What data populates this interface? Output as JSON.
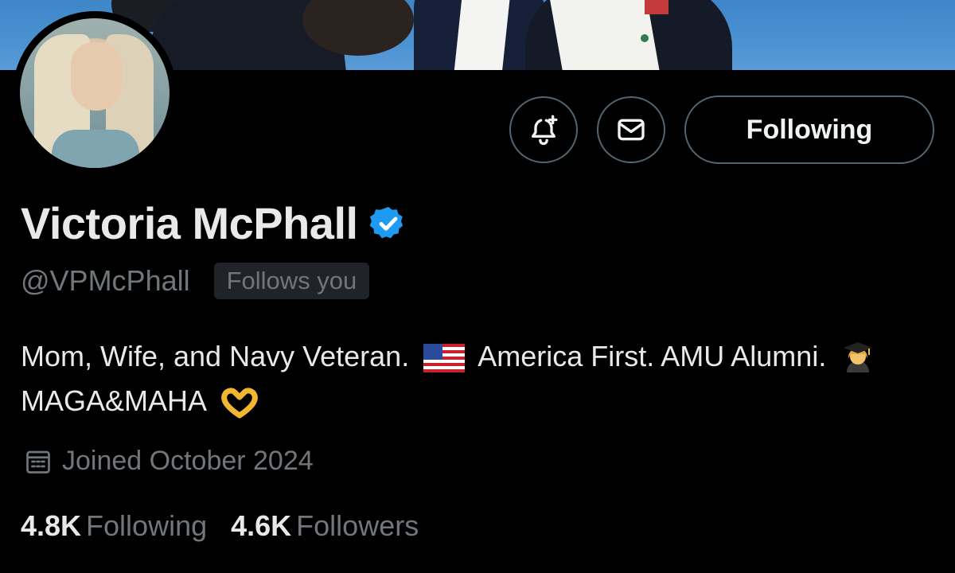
{
  "profile": {
    "name": "Victoria McPhall",
    "handle": "@VPMcPhall",
    "follows_you": "Follows you",
    "verified_icon": "verified-badge-icon"
  },
  "bio": {
    "part1": "Mom, Wife, and Navy Veteran.",
    "emoji1": "us-flag-emoji",
    "part2": "America First. AMU Alumni.",
    "emoji2": "woman-student-emoji",
    "part3": "MAGA&MAHA",
    "emoji3": "heart-hands-emoji"
  },
  "joined": {
    "icon": "calendar-icon",
    "text": "Joined October 2024"
  },
  "stats": {
    "following_count": "4.8K",
    "following_label": "Following",
    "followers_count": "4.6K",
    "followers_label": "Followers"
  },
  "actions": {
    "notify_icon": "bell-plus-icon",
    "message_icon": "envelope-icon",
    "follow_label": "Following"
  },
  "colors": {
    "background": "#000000",
    "text_primary": "#e7e9ea",
    "text_secondary": "#71767b",
    "border": "#536471",
    "verified_blue": "#1d9bf0"
  }
}
